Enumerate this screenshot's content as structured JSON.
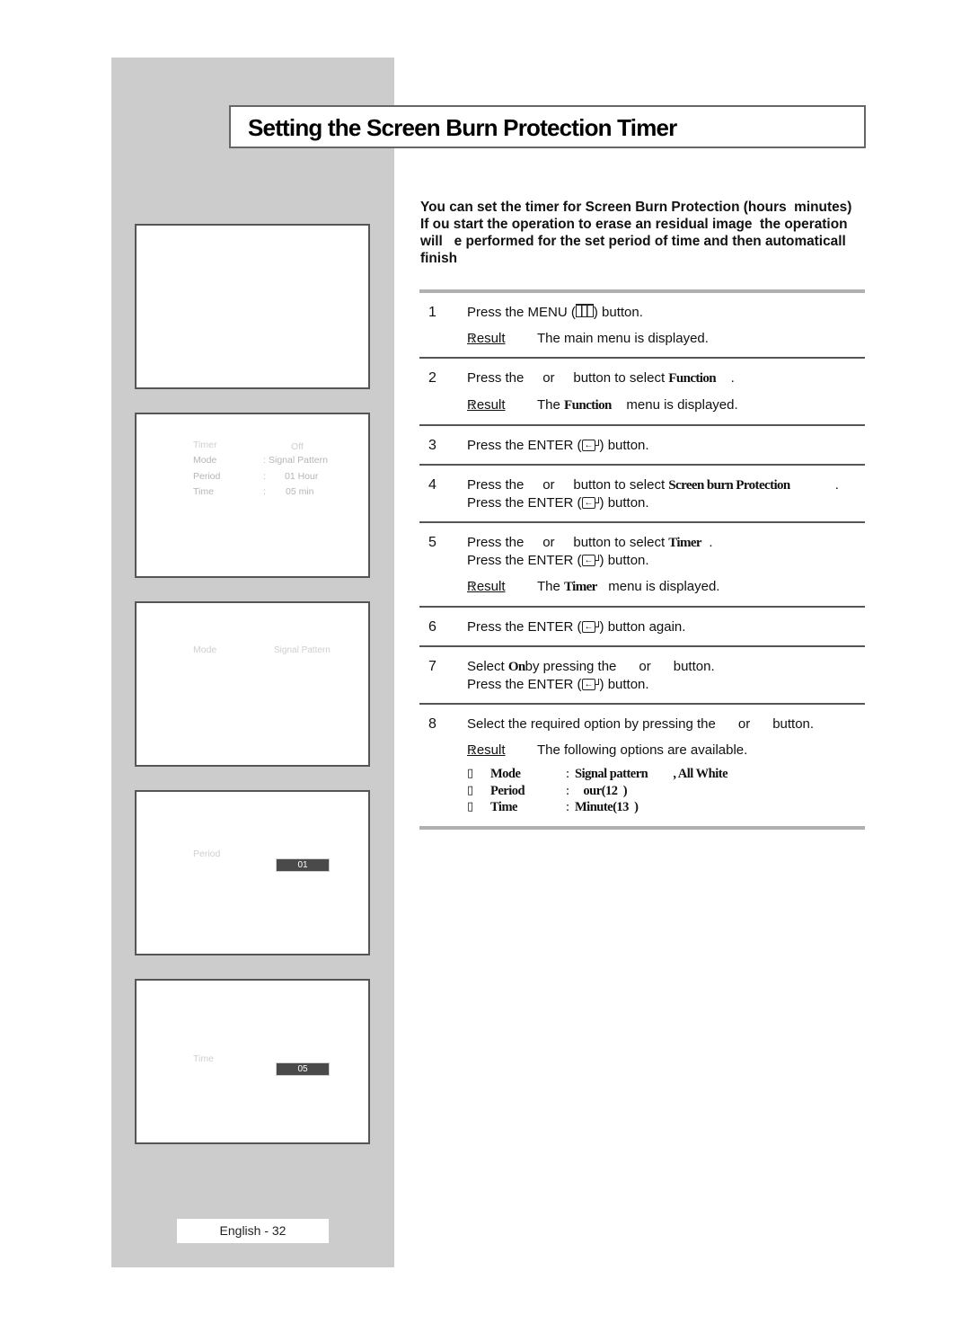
{
  "page": {
    "title": "Setting the Screen Burn Protection Timer",
    "footer": "English - 32"
  },
  "intro": {
    "lines": [
      "You can set the timer for Screen Burn Protection (hours  minutes)",
      "If ou start the operation to erase an residual image  the operation",
      "will   e performed for the set period of time and then automaticall",
      "finish"
    ]
  },
  "steps": [
    {
      "num": "1",
      "line1_a": "Press the MENU (",
      "line1_b": ") button.",
      "result_label": "Result",
      "result_text": "The main menu is displayed."
    },
    {
      "num": "2",
      "line1_a": "Press the     or     button to select ",
      "line1_bold": "Function",
      "line1_b": "    .",
      "result_label": "Result",
      "result_text_a": "The ",
      "result_bold": "Function",
      "result_text_b": "    menu is displayed."
    },
    {
      "num": "3",
      "line1_a": "Press the ENTER (",
      "line1_b": ") button."
    },
    {
      "num": "4",
      "line1_a": "Press the     or     button to select ",
      "line1_bold": "Screen burn Protection",
      "line1_b": "            .",
      "line2_a": "Press the ENTER (",
      "line2_b": ") button."
    },
    {
      "num": "5",
      "line1_a": "Press the     or     button to select ",
      "line1_bold": "Timer",
      "line1_b": "  .",
      "line2_a": "Press the ENTER (",
      "line2_b": ") button.",
      "result_label": "Result",
      "result_text_a": "The ",
      "result_bold": "Timer",
      "result_text_b": "   menu is displayed."
    },
    {
      "num": "6",
      "line1_a": "Press the ENTER (",
      "line1_b": ") button again."
    },
    {
      "num": "7",
      "line1_a": "Select ",
      "line1_bold": "On",
      "line1_b": "by pressing the      or      button.",
      "line2_a": "Press the ENTER (",
      "line2_b": ") button."
    },
    {
      "num": "8",
      "line1_a": "Select the required option by pressing the      or      button.",
      "result_label": "Result",
      "result_text": "The following options are available.",
      "options": [
        {
          "bullet": "▯",
          "name": "Mode",
          "colon": ":",
          "value": "Signal pattern         , All White"
        },
        {
          "bullet": "▯",
          "name": "Period",
          "colon": ":",
          "value": "   our(12  )"
        },
        {
          "bullet": "▯",
          "name": "Time",
          "colon": ":",
          "value": "Minute(13  )"
        }
      ]
    }
  ],
  "panels": [
    {
      "id": "blank"
    },
    {
      "id": "timer-menu",
      "rows": [
        {
          "label": "Timer",
          "sep": "",
          "value": "Off"
        },
        {
          "label": "Mode",
          "sep": ":",
          "value": "Signal Pattern"
        },
        {
          "label": "Period",
          "sep": ":",
          "value": "01 Hour"
        },
        {
          "label": "Time",
          "sep": ":",
          "value": "05 min"
        }
      ]
    },
    {
      "id": "mode",
      "label": "Mode",
      "value": "Signal Pattern"
    },
    {
      "id": "period",
      "label": "Period",
      "value": "01"
    },
    {
      "id": "time",
      "label": "Time",
      "value": "05"
    }
  ],
  "icons": {
    "menu": "menu-button-icon",
    "enter": "enter-button-icon",
    "bullet": "square-bullet-icon"
  },
  "colors": {
    "sidebar": "#cccccc",
    "border": "#555555",
    "value_box": "#4a4a4a",
    "dim_text": "#b5b5b5"
  }
}
